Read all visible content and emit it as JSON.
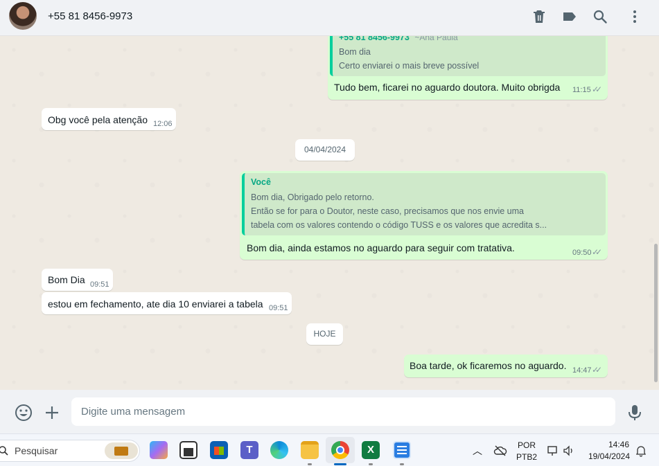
{
  "header": {
    "contact_name": "+55 81 8456-9973",
    "icons": [
      "delete-icon",
      "label-icon",
      "search-icon",
      "menu-icon"
    ]
  },
  "messages": {
    "m1": {
      "quote_author": "+55 81 8456-9973",
      "quote_author_name": "~Ana Paula",
      "quote_lines": [
        "Bom dia",
        "Certo enviarei o mais breve possível"
      ],
      "text": "Tudo bem, ficarei no aguardo doutora. Muito obrigda",
      "time": "11:15"
    },
    "m2": {
      "text": "Obg você pela atenção",
      "time": "12:06"
    },
    "date1": "04/04/2024",
    "m3": {
      "quote_author": "Você",
      "quote_lines": [
        "Bom dia, Obrigado pelo retorno.",
        "Então se for para o Doutor, neste caso, precisamos que nos envie uma",
        "tabela com os valores contendo o código TUSS e os valores que acredita s..."
      ],
      "text": "Bom dia, ainda estamos no aguardo para seguir com tratativa.",
      "time": "09:50"
    },
    "m4": {
      "text": "Bom Dia",
      "time": "09:51"
    },
    "m5": {
      "text": "estou em fechamento, ate dia 10 enviarei a tabela",
      "time": "09:51"
    },
    "date2": "HOJE",
    "m6": {
      "text": "Boa tarde, ok ficaremos no aguardo.",
      "time": "14:47"
    }
  },
  "composer": {
    "placeholder": "Digite uma mensagem",
    "icons": [
      "emoji-icon",
      "attach-plus-icon",
      "microphone-icon"
    ]
  },
  "taskbar": {
    "search_placeholder": "Pesquisar",
    "apps": [
      "briefcase",
      "copilot",
      "task-view",
      "store",
      "teams",
      "edge",
      "file-explorer",
      "chrome",
      "excel",
      "notepad"
    ],
    "lang_top": "POR",
    "lang_bottom": "PTB2",
    "time": "14:46",
    "date": "19/04/2024",
    "colors": {
      "accent": "#0067c0",
      "excel": "#107c41",
      "chrome_red": "#ea4335"
    }
  }
}
